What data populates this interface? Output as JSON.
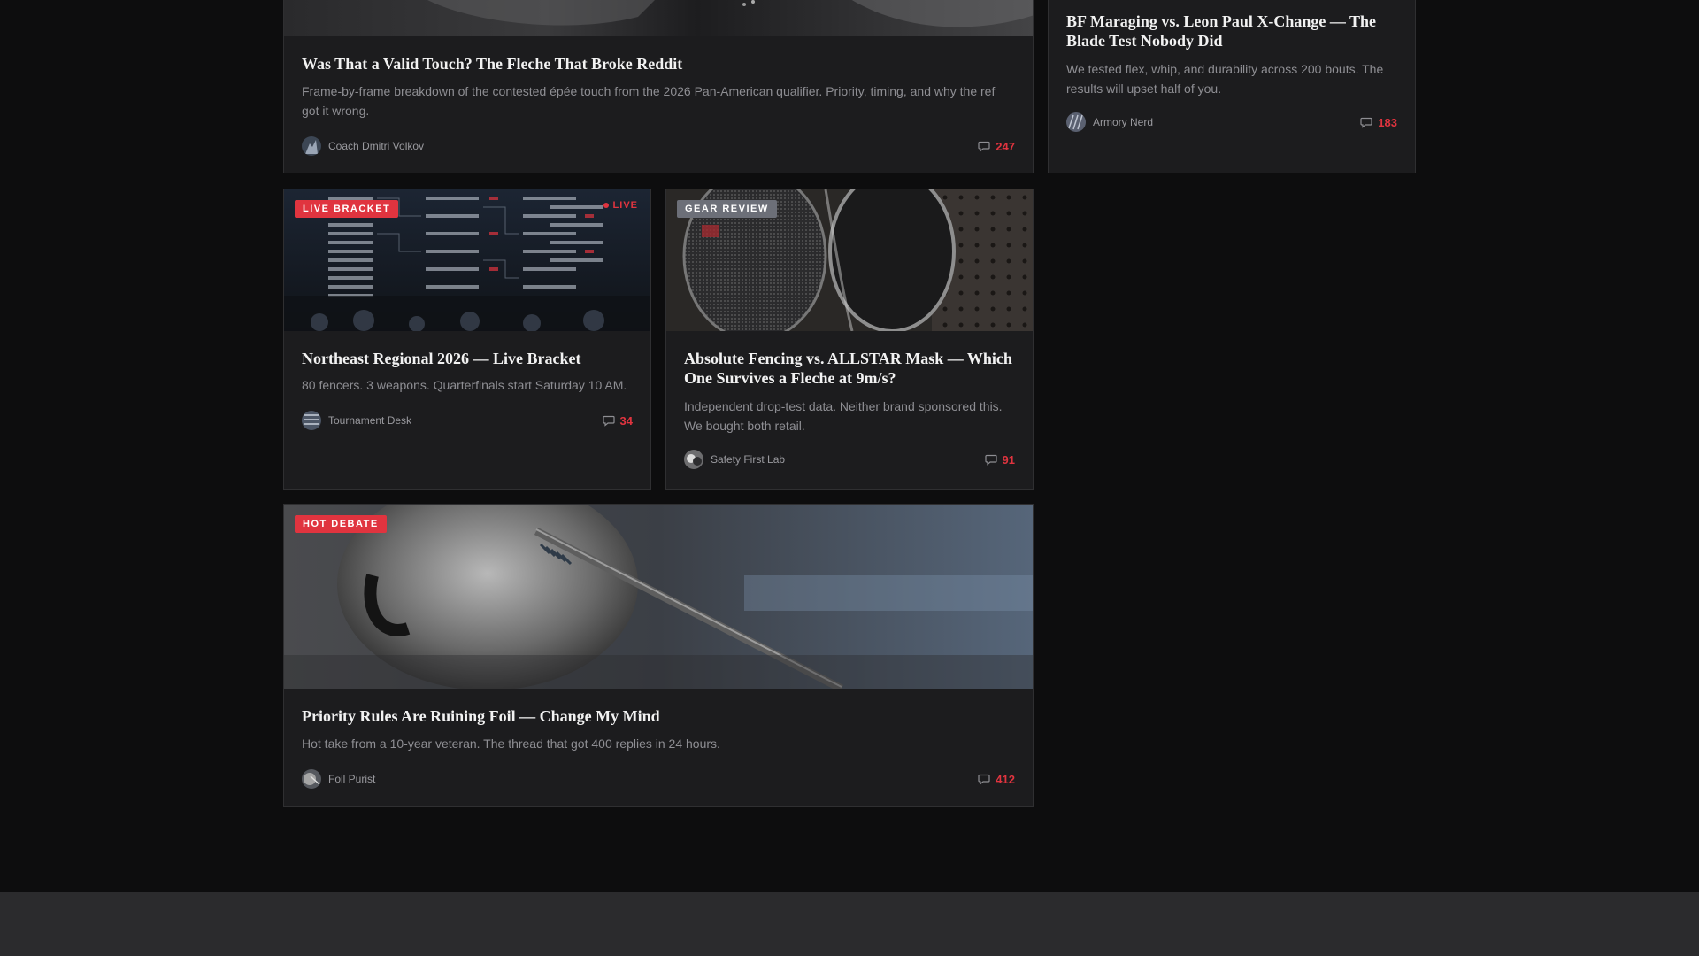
{
  "cards": {
    "fleche": {
      "title": "Was That a Valid Touch? The Fleche That Broke Reddit",
      "description": "Frame-by-frame breakdown of the contested épée touch from the 2026 Pan-American qualifier. Priority, timing, and why the ref got it wrong.",
      "author": "Coach Dmitri Volkov",
      "comments": "247"
    },
    "maraging": {
      "title": "BF Maraging vs. Leon Paul X-Change — The Blade Test Nobody Did",
      "description": "We tested flex, whip, and durability across 200 bouts. The results will upset half of you.",
      "author": "Armory Nerd",
      "comments": "183"
    },
    "regional": {
      "badge": "LIVE BRACKET",
      "live_label": "LIVE",
      "title": "Northeast Regional 2026 — Live Bracket",
      "description": "80 fencers. 3 weapons. Quarterfinals start Saturday 10 AM.",
      "author": "Tournament Desk",
      "comments": "34"
    },
    "mask": {
      "badge": "GEAR REVIEW",
      "title": "Absolute Fencing vs. ALLSTAR Mask — Which One Survives a Fleche at 9m/s?",
      "description": "Independent drop-test data. Neither brand sponsored this. We bought both retail.",
      "author": "Safety First Lab",
      "comments": "91"
    },
    "priority": {
      "badge": "HOT DEBATE",
      "title": "Priority Rules Are Ruining Foil — Change My Mind",
      "description": "Hot take from a 10-year veteran. The thread that got 400 replies in 24 hours.",
      "author": "Foil Purist",
      "comments": "412"
    }
  },
  "colors": {
    "accent": "#e0343f",
    "page_bg": "#0d0d0e",
    "card_bg": "#1c1c1e",
    "badge_grey": "#6c6f78"
  },
  "icons": {
    "comment": "comment-bubble-icon"
  }
}
